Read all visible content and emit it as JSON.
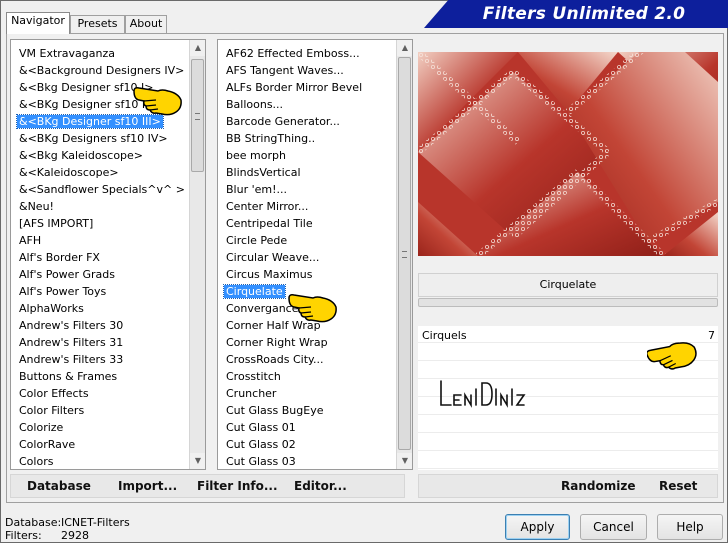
{
  "window": {
    "title": "Filters Unlimited 2.0"
  },
  "tabs": [
    {
      "label": "Navigator",
      "active": true
    },
    {
      "label": "Presets",
      "active": false
    },
    {
      "label": "About",
      "active": false
    }
  ],
  "categories": {
    "selected_index": 4,
    "items": [
      "VM Extravaganza",
      "&<Background Designers IV>",
      "&<Bkg Designer sf10 I>",
      "&<BKg Designer sf10 II>",
      "&<BKg Designer sf10 III>",
      "&<BKg Designers sf10 IV>",
      "&<Bkg Kaleidoscope>",
      "&<Kaleidoscope>",
      "&<Sandflower Specials^v^ >",
      "&Neu!",
      "[AFS IMPORT]",
      "AFH",
      "Alf's Border FX",
      "Alf's Power Grads",
      "Alf's Power Toys",
      "AlphaWorks",
      "Andrew's Filters 30",
      "Andrew's Filters 31",
      "Andrew's Filters 33",
      "Buttons & Frames",
      "Color Effects",
      "Color Filters",
      "Colorize",
      "ColorRave",
      "Colors"
    ]
  },
  "filters": {
    "selected_index": 14,
    "items": [
      "AF62 Effected Emboss...",
      "AFS Tangent Waves...",
      "ALFs Border Mirror Bevel",
      "Balloons...",
      "Barcode Generator...",
      "BB StringThing..",
      "bee morph",
      "BlindsVertical",
      "Blur 'em!...",
      "Center Mirror...",
      "Centripedal Tile",
      "Circle Pede",
      "Circular Weave...",
      "Circus Maximus",
      "Cirquelate",
      "Convergance",
      "Corner Half Wrap",
      "Corner Right Wrap",
      "CrossRoads City...",
      "Crosstitch",
      "Cruncher",
      "Cut Glass  BugEye",
      "Cut Glass 01",
      "Cut Glass 02",
      "Cut Glass 03"
    ]
  },
  "preview": {
    "colors": {
      "base": "#b8352b",
      "light": "#f2cfc2",
      "dark": "#8f1f18"
    }
  },
  "current_filter": {
    "name": "Cirquelate"
  },
  "parameters": [
    {
      "label": "Cirquels",
      "value": "7"
    }
  ],
  "signature_text": "LeniDiniz",
  "left_toolbar": {
    "database": "Database",
    "import": "Import...",
    "filter_info": "Filter Info...",
    "editor": "Editor..."
  },
  "right_toolbar": {
    "randomize": "Randomize",
    "reset": "Reset"
  },
  "status": {
    "database_label": "Database:",
    "database_value": "ICNET-Filters",
    "filters_label": "Filters:",
    "filters_value": "2928"
  },
  "buttons": {
    "apply": "Apply",
    "cancel": "Cancel",
    "help": "Help"
  },
  "colors": {
    "banner": "#0d1f9c",
    "selection": "#3390ff",
    "pointer": "#ffd400"
  }
}
